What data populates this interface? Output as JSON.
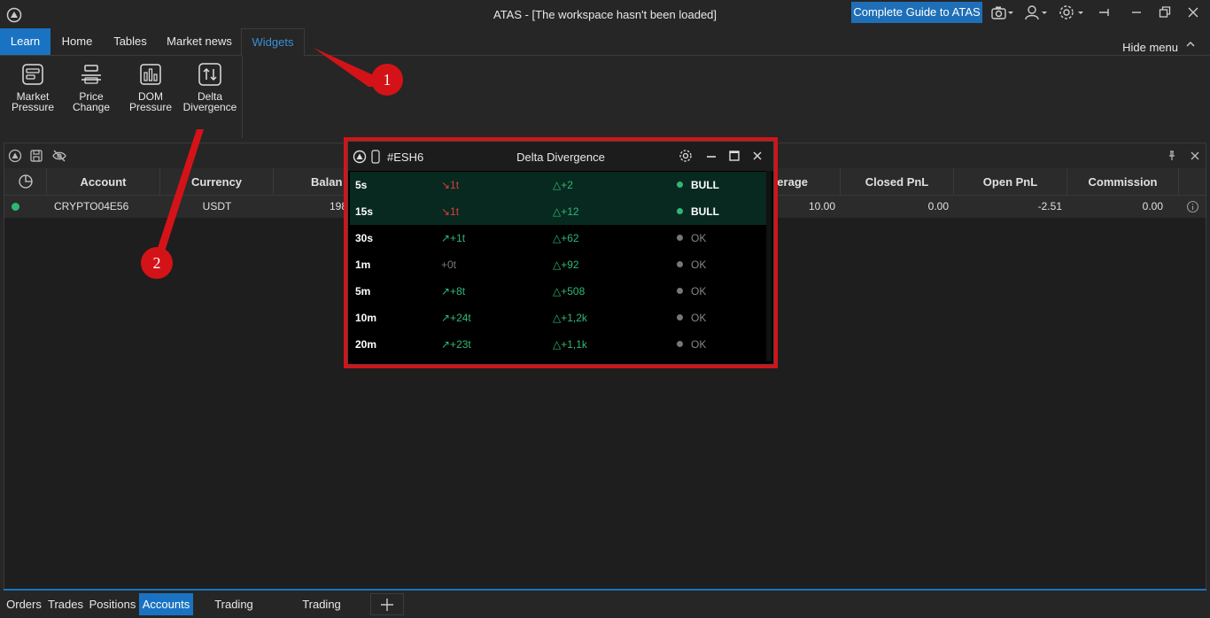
{
  "window": {
    "title": "ATAS - [The workspace hasn't been loaded]",
    "guide_button": "Complete Guide to ATAS"
  },
  "ribbon_tabs": [
    "Learn",
    "Home",
    "Tables",
    "Market news",
    "Widgets"
  ],
  "active_ribbon_tab": "Widgets",
  "hide_menu": "Hide menu",
  "widgets": [
    {
      "label": "Market\nPressure",
      "icon": "market-pressure-icon"
    },
    {
      "label": "Price\nChange",
      "icon": "price-change-icon"
    },
    {
      "label": "DOM\nPressure",
      "icon": "dom-pressure-icon"
    },
    {
      "label": "Delta\nDivergence",
      "icon": "delta-divergence-icon"
    }
  ],
  "accounts_table": {
    "columns": [
      "Account",
      "Currency",
      "Balan",
      "erage",
      "Closed PnL",
      "Open PnL",
      "Commission"
    ],
    "row": {
      "account": "CRYPTO04E56",
      "currency": "USDT",
      "balance": "198",
      "leverage": "10.00",
      "closed_pnl": "0.00",
      "open_pnl": "-2.51",
      "commission": "0.00"
    }
  },
  "delta_divergence": {
    "symbol": "#ESH6",
    "title": "Delta Divergence",
    "rows": [
      {
        "tf": "5s",
        "d1": "↘1t",
        "d2": "△+2",
        "status": "BULL",
        "kind": "bull"
      },
      {
        "tf": "15s",
        "d1": "↘1t",
        "d2": "△+12",
        "status": "BULL",
        "kind": "bull"
      },
      {
        "tf": "30s",
        "d1": "↗+1t",
        "d2": "△+62",
        "status": "OK",
        "kind": "ok"
      },
      {
        "tf": "1m",
        "d1": "+0t",
        "d2": "△+92",
        "status": "OK",
        "kind": "ok"
      },
      {
        "tf": "5m",
        "d1": "↗+8t",
        "d2": "△+508",
        "status": "OK",
        "kind": "ok"
      },
      {
        "tf": "10m",
        "d1": "↗+24t",
        "d2": "△+1,2k",
        "status": "OK",
        "kind": "ok"
      },
      {
        "tf": "20m",
        "d1": "↗+23t",
        "d2": "△+1,1k",
        "status": "OK",
        "kind": "ok"
      }
    ]
  },
  "bottom_tabs": [
    "Orders",
    "Trades",
    "Positions",
    "Accounts",
    "Trading Journal",
    "Trading strategies"
  ],
  "active_bottom_tab": "Accounts",
  "annotations": [
    "1",
    "2"
  ],
  "colors": {
    "accent": "#1a73c2",
    "highlight": "#d41318",
    "bull": "#2fb875",
    "bear": "#e03c3c"
  }
}
